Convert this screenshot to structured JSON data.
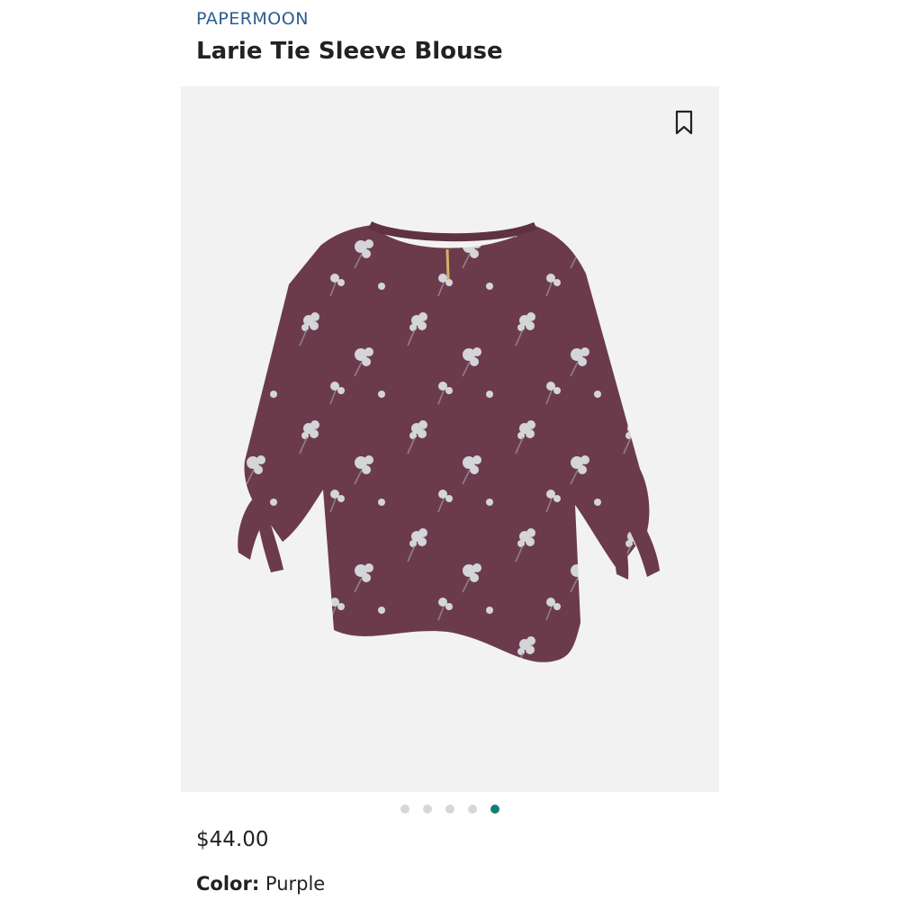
{
  "product": {
    "brand": "PAPERMOON",
    "name": "Larie Tie Sleeve Blouse",
    "price": "$44.00",
    "color_label": "Color:",
    "color_value": "Purple"
  },
  "gallery": {
    "total_images": 5,
    "active_index": 4
  },
  "colors": {
    "brand_blue": "#2d5d8f",
    "active_dot": "#0f7f77",
    "blouse": "#6b3b4c",
    "flower": "#dfe6e8",
    "image_bg": "#f2f2f2"
  },
  "icons": {
    "bookmark": "bookmark-icon"
  }
}
